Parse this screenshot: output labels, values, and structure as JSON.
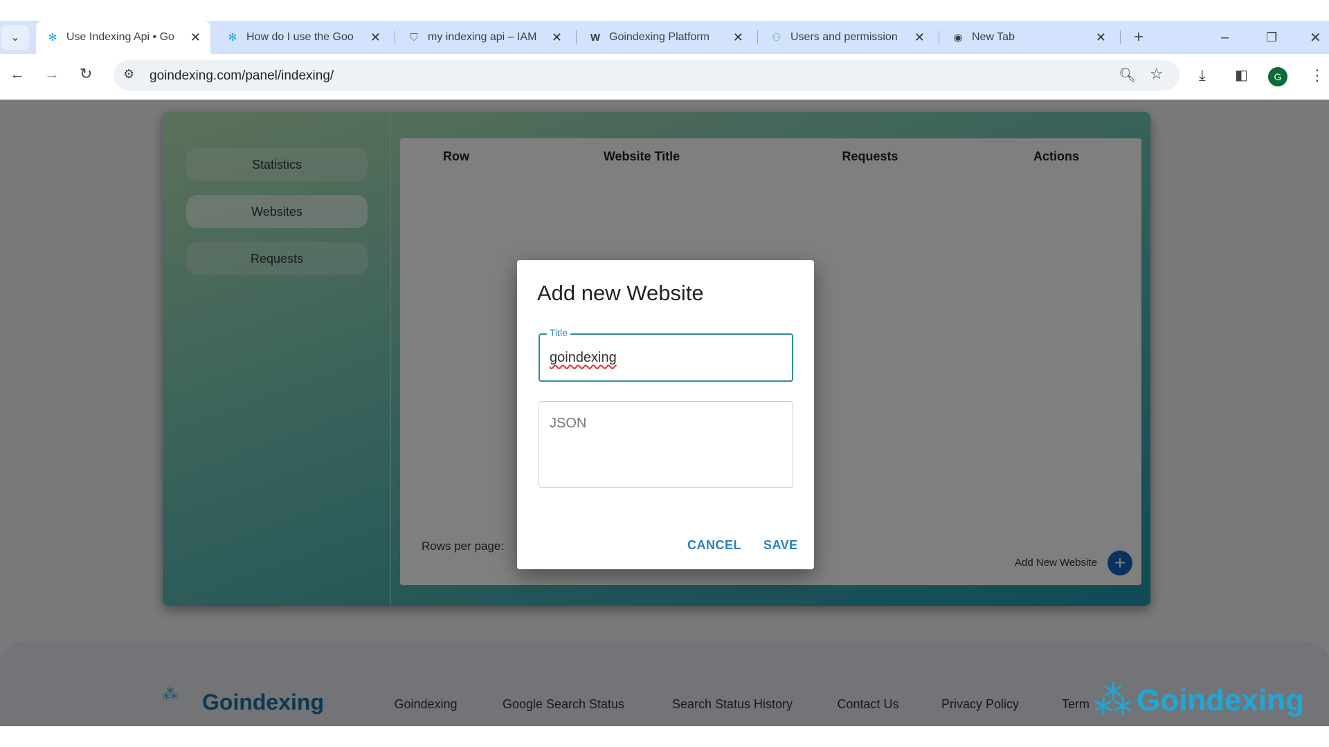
{
  "browser": {
    "tabs": [
      {
        "title": "Use Indexing Api • Go",
        "icon": "goindexing-icon",
        "active": true
      },
      {
        "title": "How do I use the Goo",
        "icon": "goindexing-icon"
      },
      {
        "title": "my indexing api – IAM",
        "icon": "shield-icon"
      },
      {
        "title": "Goindexing Platform",
        "icon": "w-logo-icon"
      },
      {
        "title": "Users and permission",
        "icon": "users-icon"
      },
      {
        "title": "New Tab",
        "icon": "chrome-icon"
      }
    ],
    "url": "goindexing.com/panel/indexing/",
    "profile_initial": "G"
  },
  "sidebar": {
    "items": [
      {
        "label": "Statistics"
      },
      {
        "label": "Websites",
        "active": true
      },
      {
        "label": "Requests"
      }
    ]
  },
  "table": {
    "columns": [
      "Row",
      "Website Title",
      "Requests",
      "Actions"
    ],
    "rows_per_page_label": "Rows per page:",
    "add_label": "Add New Website"
  },
  "footer": {
    "brand": "Goindexing",
    "links": [
      "Goindexing",
      "Google Search Status",
      "Search Status History",
      "Contact Us",
      "Privacy Policy",
      "Term"
    ]
  },
  "watermark": "Goindexing",
  "modal": {
    "title": "Add new Website",
    "title_label": "Title",
    "title_value": "goindexing",
    "json_placeholder": "JSON",
    "cancel": "CANCEL",
    "save": "SAVE"
  },
  "colors": {
    "accent": "#2a7fc4",
    "focus": "#2b8c9c",
    "brand": "#1fa7d8"
  }
}
